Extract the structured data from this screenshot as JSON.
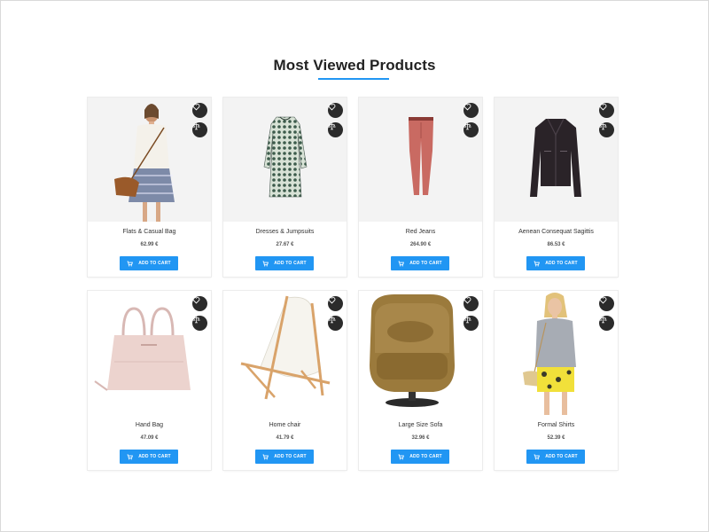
{
  "section": {
    "title": "Most Viewed Products",
    "accent_color": "#2196f3"
  },
  "products": [
    {
      "name": "Flats & Casual Bag",
      "price": "62.99 €",
      "button_label": "ADD TO CART",
      "image_icon": "woman-with-bag"
    },
    {
      "name": "Dresses & Jumpsuits",
      "price": "27.67 €",
      "button_label": "ADD TO CART",
      "image_icon": "patterned-dress"
    },
    {
      "name": "Red Jeans",
      "price": "264.90 €",
      "button_label": "ADD TO CART",
      "image_icon": "red-jeans"
    },
    {
      "name": "Aenean Consequat Sagittis",
      "price": "86.53 €",
      "button_label": "ADD TO CART",
      "image_icon": "leather-jacket"
    },
    {
      "name": "Hand Bag",
      "price": "47.09 €",
      "button_label": "ADD TO CART",
      "image_icon": "pink-handbag"
    },
    {
      "name": "Home chair",
      "price": "41.79 €",
      "button_label": "ADD TO CART",
      "image_icon": "deck-chair"
    },
    {
      "name": "Large Size Sofa",
      "price": "32.96 €",
      "button_label": "ADD TO CART",
      "image_icon": "armchair"
    },
    {
      "name": "Formal Shirts",
      "price": "52.39 €",
      "button_label": "ADD TO CART",
      "image_icon": "woman-in-shirt"
    }
  ],
  "icons": {
    "wishlist": "heart-icon",
    "compare": "scale-icon",
    "cart": "cart-icon"
  }
}
